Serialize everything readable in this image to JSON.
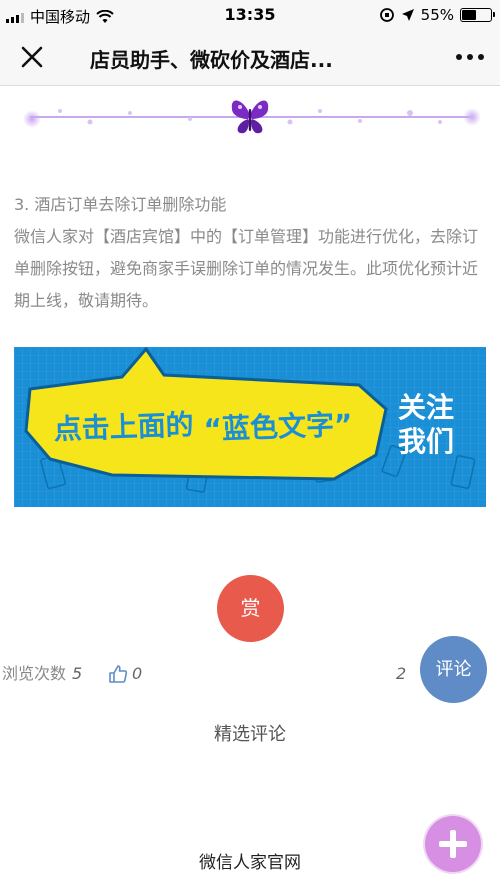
{
  "status": {
    "carrier": "中国移动",
    "time": "13:35",
    "battery": "55%",
    "battery_level": 0.55
  },
  "nav": {
    "title": "店员助手、微砍价及酒店..."
  },
  "article": {
    "heading": "3. 酒店订单去除订单删除功能",
    "body": "微信人家对【酒店宾馆】中的【订单管理】功能进行优化，去除订单删除按钮，避免商家手误删除订单的情况发生。此项优化预计近期上线，敬请期待。"
  },
  "banner": {
    "text_main": "点击上面的",
    "text_quote": "“蓝色文字”",
    "text_side_1": "关注",
    "text_side_2": "我们",
    "colors": {
      "background": "#1a8fd6",
      "bubble": "#f7e51c",
      "text": "#1a8fd6"
    }
  },
  "reward": {
    "label": "赏"
  },
  "stats": {
    "views_label": "浏览次数",
    "views_count": "5",
    "likes_count": "0",
    "right_count": "2"
  },
  "comment_button": {
    "label": "评论"
  },
  "featured_comments": {
    "label": "精选评论"
  },
  "footer": {
    "account_name": "微信人家官网"
  }
}
